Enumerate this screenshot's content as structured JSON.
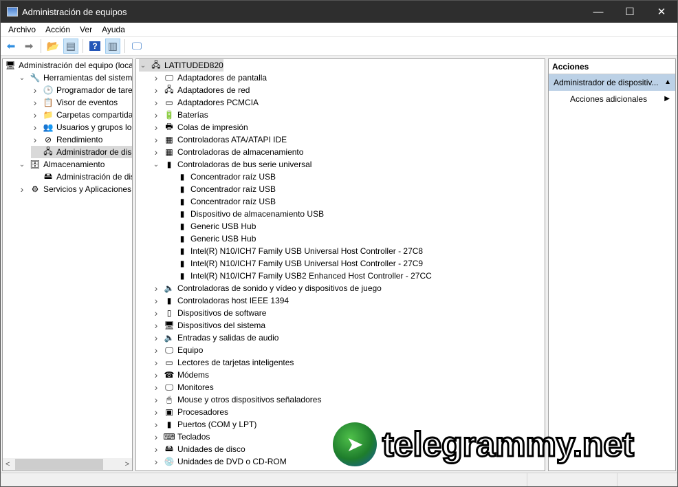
{
  "window": {
    "title": "Administración de equipos",
    "minimize": "—",
    "maximize": "☐",
    "close": "✕"
  },
  "menu": [
    "Archivo",
    "Acción",
    "Ver",
    "Ayuda"
  ],
  "toolbar": [
    {
      "icon": "back-icon",
      "g": "⬅",
      "color": "#2f8ee0"
    },
    {
      "icon": "forward-icon",
      "g": "➡",
      "color": "#777"
    },
    {
      "sep": true
    },
    {
      "icon": "up-folder-icon",
      "g": "📂",
      "color": "#d9a520"
    },
    {
      "icon": "show-hide-console-tree-icon",
      "g": "▤",
      "color": "#567",
      "pressed": true
    },
    {
      "sep": true
    },
    {
      "icon": "help-icon",
      "g": "?",
      "color": "#fff",
      "bg": "#2456b8"
    },
    {
      "icon": "show-hide-action-pane-icon",
      "g": "▥",
      "color": "#567",
      "pressed": true
    },
    {
      "sep": true
    },
    {
      "icon": "monitor-icon",
      "g": "🖵",
      "color": "#3a7ac8"
    }
  ],
  "left_tree": [
    {
      "label": "Administración del equipo (local)",
      "level": 0,
      "tw": "",
      "icon": "computer-management-icon",
      "g": "🖥"
    },
    {
      "label": "Herramientas del sistema",
      "level": 1,
      "tw": "v",
      "icon": "tools-icon",
      "g": "🔧"
    },
    {
      "label": "Programador de tareas",
      "level": 2,
      "tw": ">",
      "icon": "clock-icon",
      "g": "🕒"
    },
    {
      "label": "Visor de eventos",
      "level": 2,
      "tw": ">",
      "icon": "event-viewer-icon",
      "g": "📋"
    },
    {
      "label": "Carpetas compartidas",
      "level": 2,
      "tw": ">",
      "icon": "shared-folder-icon",
      "g": "📁"
    },
    {
      "label": "Usuarios y grupos locales",
      "level": 2,
      "tw": ">",
      "icon": "users-icon",
      "g": "👥"
    },
    {
      "label": "Rendimiento",
      "level": 2,
      "tw": ">",
      "icon": "performance-icon",
      "g": "⊘"
    },
    {
      "label": "Administrador de dispositivos",
      "level": 2,
      "tw": "",
      "icon": "device-manager-icon",
      "g": "🖧",
      "selected": true
    },
    {
      "label": "Almacenamiento",
      "level": 1,
      "tw": "v",
      "icon": "storage-icon",
      "g": "🗄"
    },
    {
      "label": "Administración de discos",
      "level": 2,
      "tw": "",
      "icon": "disk-icon",
      "g": "🖴"
    },
    {
      "label": "Servicios y Aplicaciones",
      "level": 1,
      "tw": ">",
      "icon": "services-icon",
      "g": "⚙"
    }
  ],
  "device_tree": [
    {
      "label": "LATITUDED820",
      "level": 0,
      "tw": "v",
      "icon": "computer-icon",
      "g": "🖧",
      "selected": true
    },
    {
      "label": "Adaptadores de pantalla",
      "level": 1,
      "tw": ">",
      "icon": "display-adapter-icon",
      "g": "🖵"
    },
    {
      "label": "Adaptadores de red",
      "level": 1,
      "tw": ">",
      "icon": "network-adapter-icon",
      "g": "🖧"
    },
    {
      "label": "Adaptadores PCMCIA",
      "level": 1,
      "tw": ">",
      "icon": "pcmcia-icon",
      "g": "▭"
    },
    {
      "label": "Baterías",
      "level": 1,
      "tw": ">",
      "icon": "battery-icon",
      "g": "🔋"
    },
    {
      "label": "Colas de impresión",
      "level": 1,
      "tw": ">",
      "icon": "printer-icon",
      "g": "🖶"
    },
    {
      "label": "Controladoras ATA/ATAPI IDE",
      "level": 1,
      "tw": ">",
      "icon": "ide-controller-icon",
      "g": "▦"
    },
    {
      "label": "Controladoras de almacenamiento",
      "level": 1,
      "tw": ">",
      "icon": "storage-controller-icon",
      "g": "▦"
    },
    {
      "label": "Controladoras de bus serie universal",
      "level": 1,
      "tw": "v",
      "icon": "usb-icon",
      "g": "▮"
    },
    {
      "label": "Concentrador raíz USB",
      "level": 2,
      "tw": "",
      "icon": "usb-icon",
      "g": "▮"
    },
    {
      "label": "Concentrador raíz USB",
      "level": 2,
      "tw": "",
      "icon": "usb-icon",
      "g": "▮"
    },
    {
      "label": "Concentrador raíz USB",
      "level": 2,
      "tw": "",
      "icon": "usb-icon",
      "g": "▮"
    },
    {
      "label": "Dispositivo de almacenamiento USB",
      "level": 2,
      "tw": "",
      "icon": "usb-icon",
      "g": "▮"
    },
    {
      "label": "Generic USB Hub",
      "level": 2,
      "tw": "",
      "icon": "usb-icon",
      "g": "▮"
    },
    {
      "label": "Generic USB Hub",
      "level": 2,
      "tw": "",
      "icon": "usb-icon",
      "g": "▮"
    },
    {
      "label": "Intel(R) N10/ICH7 Family USB Universal Host Controller - 27C8",
      "level": 2,
      "tw": "",
      "icon": "usb-icon",
      "g": "▮"
    },
    {
      "label": "Intel(R) N10/ICH7 Family USB Universal Host Controller - 27C9",
      "level": 2,
      "tw": "",
      "icon": "usb-icon",
      "g": "▮"
    },
    {
      "label": "Intel(R) N10/ICH7 Family USB2 Enhanced Host Controller - 27CC",
      "level": 2,
      "tw": "",
      "icon": "usb-icon",
      "g": "▮"
    },
    {
      "label": "Controladoras de sonido y vídeo y dispositivos de juego",
      "level": 1,
      "tw": ">",
      "icon": "speaker-icon",
      "g": "🔈"
    },
    {
      "label": "Controladoras host IEEE 1394",
      "level": 1,
      "tw": ">",
      "icon": "ieee1394-icon",
      "g": "▮"
    },
    {
      "label": "Dispositivos de software",
      "level": 1,
      "tw": ">",
      "icon": "software-device-icon",
      "g": "▯"
    },
    {
      "label": "Dispositivos del sistema",
      "level": 1,
      "tw": ">",
      "icon": "system-device-icon",
      "g": "🖥"
    },
    {
      "label": "Entradas y salidas de audio",
      "level": 1,
      "tw": ">",
      "icon": "audio-icon",
      "g": "🔈"
    },
    {
      "label": "Equipo",
      "level": 1,
      "tw": ">",
      "icon": "computer-icon",
      "g": "🖵"
    },
    {
      "label": "Lectores de tarjetas inteligentes",
      "level": 1,
      "tw": ">",
      "icon": "smart-card-icon",
      "g": "▭"
    },
    {
      "label": "Módems",
      "level": 1,
      "tw": ">",
      "icon": "modem-icon",
      "g": "☎"
    },
    {
      "label": "Monitores",
      "level": 1,
      "tw": ">",
      "icon": "monitor-icon",
      "g": "🖵"
    },
    {
      "label": "Mouse y otros dispositivos señaladores",
      "level": 1,
      "tw": ">",
      "icon": "mouse-icon",
      "g": "🖱"
    },
    {
      "label": "Procesadores",
      "level": 1,
      "tw": ">",
      "icon": "processor-icon",
      "g": "▣"
    },
    {
      "label": "Puertos (COM y LPT)",
      "level": 1,
      "tw": ">",
      "icon": "port-icon",
      "g": "▮"
    },
    {
      "label": "Teclados",
      "level": 1,
      "tw": ">",
      "icon": "keyboard-icon",
      "g": "⌨"
    },
    {
      "label": "Unidades de disco",
      "level": 1,
      "tw": ">",
      "icon": "disk-drive-icon",
      "g": "🖴"
    },
    {
      "label": "Unidades de DVD o CD-ROM",
      "level": 1,
      "tw": ">",
      "icon": "dvd-icon",
      "g": "💿"
    }
  ],
  "actions": {
    "header": "Acciones",
    "section": "Administrador de dispositiv...",
    "item": "Acciones adicionales"
  },
  "watermark": {
    "text": "telegrammy.net"
  }
}
